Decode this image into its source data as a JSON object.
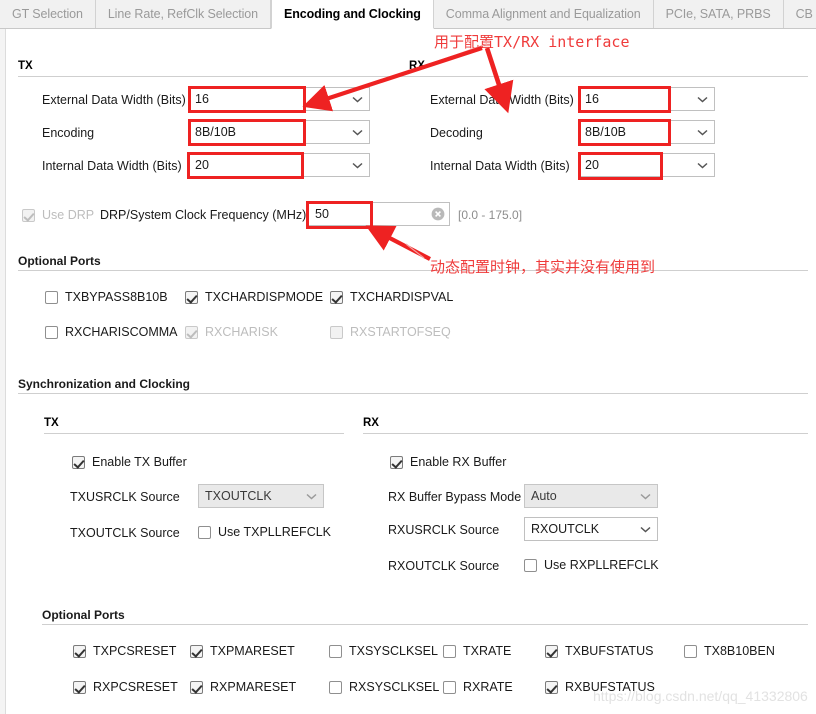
{
  "tabs": [
    {
      "label": "GT Selection",
      "active": false
    },
    {
      "label": "Line Rate, RefClk Selection",
      "active": false
    },
    {
      "label": "Encoding and Clocking",
      "active": true
    },
    {
      "label": "Comma Alignment and Equalization",
      "active": false
    },
    {
      "label": "PCIe, SATA, PRBS",
      "active": false
    },
    {
      "label": "CB and",
      "active": false
    }
  ],
  "encoding": {
    "tx_group_label": "TX",
    "rx_group_label": "RX",
    "tx": {
      "external_data_width_label": "External Data Width (Bits)",
      "external_data_width_value": "16",
      "encoding_label": "Encoding",
      "encoding_value": "8B/10B",
      "internal_data_width_label": "Internal Data Width (Bits)",
      "internal_data_width_value": "20"
    },
    "rx": {
      "external_data_width_label": "External Data Width (Bits)",
      "external_data_width_value": "16",
      "decoding_label": "Decoding",
      "decoding_value": "8B/10B",
      "internal_data_width_label": "Internal Data Width (Bits)",
      "internal_data_width_value": "20"
    },
    "drp": {
      "use_drp_label": "Use DRP",
      "use_drp_checked": true,
      "freq_label": "DRP/System Clock Frequency (MHz)",
      "freq_value": "50",
      "range_hint": "[0.0 - 175.0]"
    }
  },
  "optional_ports_top": {
    "title": "Optional Ports",
    "rows": [
      [
        {
          "label": "TXBYPASS8B10B",
          "checked": false,
          "disabled": false
        },
        {
          "label": "TXCHARDISPMODE",
          "checked": true,
          "disabled": false
        },
        {
          "label": "TXCHARDISPVAL",
          "checked": true,
          "disabled": false
        }
      ],
      [
        {
          "label": "RXCHARISCOMMA",
          "checked": false,
          "disabled": false
        },
        {
          "label": "RXCHARISK",
          "checked": true,
          "disabled": true
        },
        {
          "label": "RXSTARTOFSEQ",
          "checked": false,
          "disabled": true
        }
      ]
    ]
  },
  "sync": {
    "title": "Synchronization and Clocking",
    "tx_group_label": "TX",
    "rx_group_label": "RX",
    "tx": {
      "enable_buffer_label": "Enable TX Buffer",
      "enable_buffer_checked": true,
      "usrclk_label": "TXUSRCLK Source",
      "usrclk_value": "TXOUTCLK",
      "usrclk_disabled": true,
      "outclk_label": "TXOUTCLK Source",
      "use_pllrefclk_label": "Use TXPLLREFCLK",
      "use_pllrefclk_checked": false
    },
    "rx": {
      "enable_buffer_label": "Enable RX Buffer",
      "enable_buffer_checked": true,
      "bypass_mode_label": "RX Buffer Bypass Mode",
      "bypass_mode_value": "Auto",
      "bypass_mode_disabled": true,
      "usrclk_label": "RXUSRCLK Source",
      "usrclk_value": "RXOUTCLK",
      "usrclk_disabled": false,
      "outclk_label": "RXOUTCLK Source",
      "use_pllrefclk_label": "Use RXPLLREFCLK",
      "use_pllrefclk_checked": false
    }
  },
  "optional_ports_bottom": {
    "title": "Optional Ports",
    "rows": [
      [
        {
          "label": "TXPCSRESET",
          "checked": true
        },
        {
          "label": "TXPMARESET",
          "checked": true
        },
        {
          "label": "TXSYSCLKSEL",
          "checked": false
        },
        {
          "label": "TXRATE",
          "checked": false
        },
        {
          "label": "TXBUFSTATUS",
          "checked": true
        },
        {
          "label": "TX8B10BEN",
          "checked": false
        }
      ],
      [
        {
          "label": "RXPCSRESET",
          "checked": true
        },
        {
          "label": "RXPMARESET",
          "checked": true
        },
        {
          "label": "RXSYSCLKSEL",
          "checked": false
        },
        {
          "label": "RXRATE",
          "checked": false
        },
        {
          "label": "RXBUFSTATUS",
          "checked": true
        }
      ]
    ]
  },
  "annotations": {
    "color": "#ef3b3b",
    "note_1_cn": "用于配置",
    "note_1_en": "TX/RX interface",
    "note_2": "动态配置时钟，其实并没有使用到"
  },
  "watermark": "https://blog.csdn.net/qq_41332806"
}
